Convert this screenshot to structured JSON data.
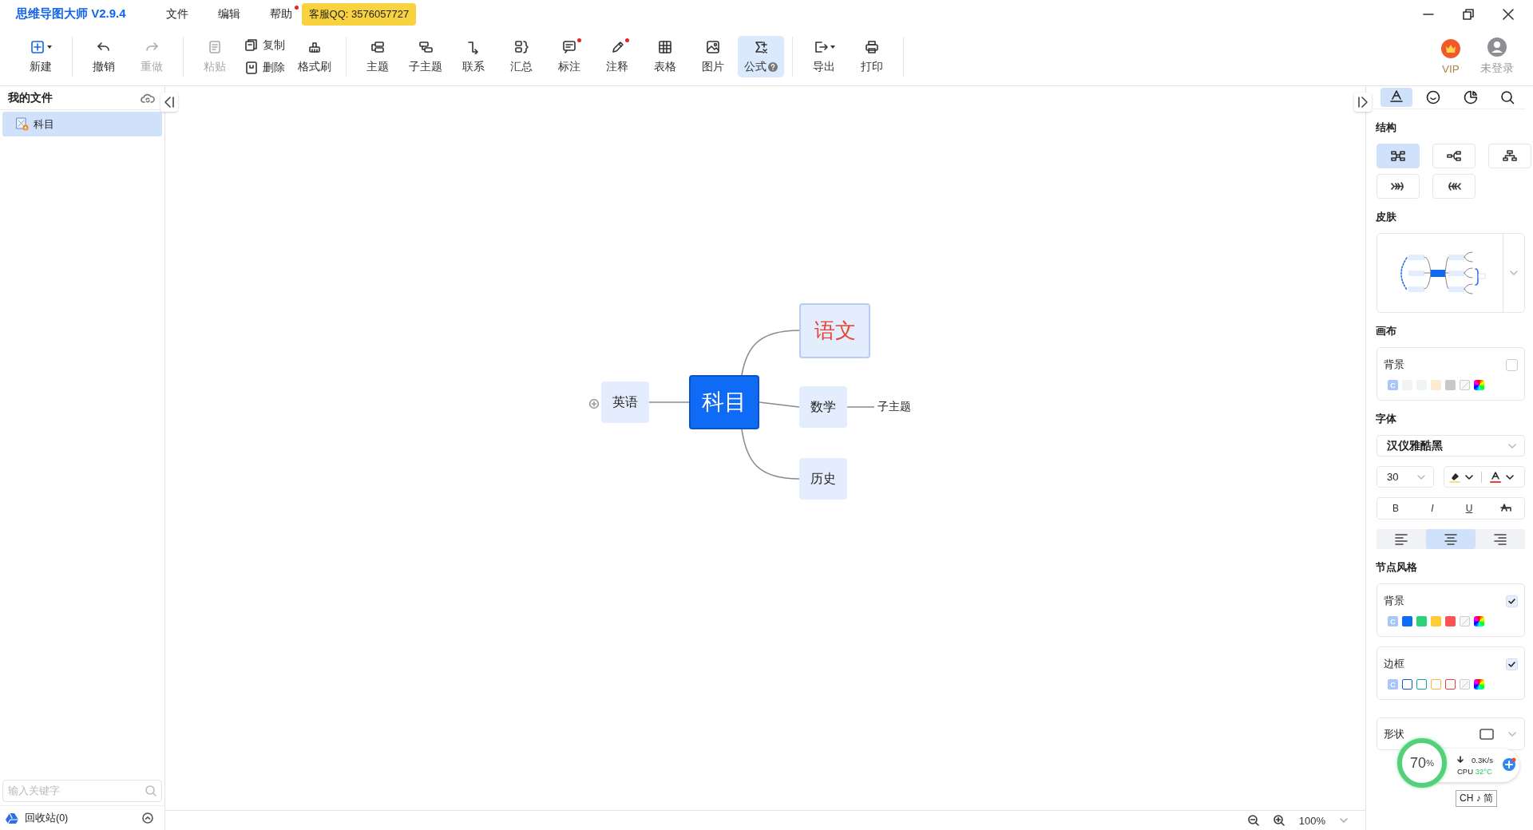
{
  "app": {
    "title": "思维导图大师 V2.9.4",
    "menus": [
      {
        "label": "文件",
        "dot": false
      },
      {
        "label": "编辑",
        "dot": false
      },
      {
        "label": "帮助",
        "dot": true
      }
    ],
    "support_badge": "客服QQ: 3576057727"
  },
  "toolbar": {
    "groups": [
      [
        {
          "kind": "new",
          "label": "新建",
          "dropdown": true,
          "disabled": false,
          "selected": false,
          "dot": false
        }
      ],
      [
        {
          "kind": "undo",
          "label": "撤销",
          "dropdown": false,
          "disabled": false,
          "selected": false,
          "dot": false
        },
        {
          "kind": "redo",
          "label": "重做",
          "dropdown": false,
          "disabled": true,
          "selected": false,
          "dot": false
        }
      ],
      [
        {
          "kind": "paste",
          "label": "粘贴",
          "dropdown": false,
          "disabled": true,
          "selected": false,
          "dot": false
        },
        {
          "kind": "pair",
          "items": [
            {
              "kind": "copy",
              "label": "复制"
            },
            {
              "kind": "delete",
              "label": "删除"
            }
          ]
        },
        {
          "kind": "brush",
          "label": "格式刷",
          "dropdown": false,
          "disabled": false,
          "selected": false,
          "dot": false
        }
      ],
      [
        {
          "kind": "topic",
          "label": "主题",
          "dropdown": false,
          "disabled": false,
          "selected": false,
          "dot": false
        },
        {
          "kind": "subtopic",
          "label": "子主题",
          "dropdown": false,
          "disabled": false,
          "selected": false,
          "dot": false
        },
        {
          "kind": "relation",
          "label": "联系",
          "dropdown": false,
          "disabled": false,
          "selected": false,
          "dot": false
        },
        {
          "kind": "summary",
          "label": "汇总",
          "dropdown": false,
          "disabled": false,
          "selected": false,
          "dot": false
        },
        {
          "kind": "note",
          "label": "标注",
          "dropdown": false,
          "disabled": false,
          "selected": false,
          "dot": true
        },
        {
          "kind": "comment",
          "label": "注释",
          "dropdown": false,
          "disabled": false,
          "selected": false,
          "dot": true
        },
        {
          "kind": "table",
          "label": "表格",
          "dropdown": false,
          "disabled": false,
          "selected": false,
          "dot": false
        },
        {
          "kind": "image",
          "label": "图片",
          "dropdown": false,
          "disabled": false,
          "selected": false,
          "dot": false
        },
        {
          "kind": "formula",
          "label": "公式",
          "dropdown": false,
          "disabled": false,
          "selected": true,
          "dot": false
        }
      ],
      [
        {
          "kind": "export",
          "label": "导出",
          "dropdown": true,
          "disabled": false,
          "selected": false,
          "dot": false
        },
        {
          "kind": "print",
          "label": "打印",
          "dropdown": false,
          "disabled": false,
          "selected": false,
          "dot": false
        }
      ]
    ],
    "account": {
      "vip": "VIP",
      "login": "未登录"
    }
  },
  "sidebar": {
    "title": "我的文件",
    "files": [
      {
        "label": "科目",
        "selected": true
      }
    ],
    "search": {
      "placeholder": "输入关键字"
    },
    "recycle": "回收站(0)"
  },
  "mindmap": {
    "root": "科目",
    "right_branches": [
      {
        "label": "语文",
        "selected": true,
        "collapsed": false,
        "color": "#e8432e"
      },
      {
        "label": "数学",
        "selected": false,
        "collapsed": false,
        "color": "#222222",
        "children": [
          {
            "label": "子主题"
          }
        ]
      },
      {
        "label": "历史",
        "selected": false,
        "collapsed": false,
        "color": "#222222"
      }
    ],
    "left_branches": [
      {
        "label": "英语",
        "selected": false,
        "collapsed": true,
        "color": "#222222"
      }
    ]
  },
  "panel": {
    "tabs": [
      {
        "kind": "style",
        "selected": true
      },
      {
        "kind": "emoji",
        "selected": false
      },
      {
        "kind": "sticker",
        "selected": false
      },
      {
        "kind": "search",
        "selected": false
      }
    ],
    "structure": {
      "title": "结构",
      "options": [
        {
          "kind": "mind",
          "selected": true
        },
        {
          "kind": "right",
          "selected": false
        },
        {
          "kind": "org",
          "selected": false
        },
        {
          "kind": "fishright",
          "selected": false
        },
        {
          "kind": "fishleft",
          "selected": false
        }
      ]
    },
    "skin": {
      "title": "皮肤"
    },
    "canvas": {
      "title": "画布",
      "background": {
        "label": "背景",
        "checked": false,
        "swatches": [
          {
            "kind": "custom",
            "text": "C"
          },
          {
            "kind": "color",
            "color": "#f2f3f5"
          },
          {
            "kind": "color",
            "color": "#eff5f5"
          },
          {
            "kind": "color",
            "color": "#fdebd0"
          },
          {
            "kind": "color",
            "color": "#c8c8c8"
          },
          {
            "kind": "none"
          },
          {
            "kind": "picker"
          }
        ]
      }
    },
    "font": {
      "title": "字体",
      "family": "汉仪雅酷黑",
      "size": "30",
      "styles": [
        {
          "kind": "bold",
          "text": "B"
        },
        {
          "kind": "italic",
          "text": "I"
        },
        {
          "kind": "underline",
          "text": "U"
        },
        {
          "kind": "strike"
        }
      ],
      "align": [
        {
          "kind": "left",
          "selected": false
        },
        {
          "kind": "center",
          "selected": true
        },
        {
          "kind": "right",
          "selected": false
        }
      ]
    },
    "node_style": {
      "title": "节点风格",
      "background": {
        "label": "背景",
        "checked": true,
        "swatches": [
          {
            "kind": "custom",
            "text": "C"
          },
          {
            "kind": "color",
            "color": "#0f6af5"
          },
          {
            "kind": "color",
            "color": "#2bd27a"
          },
          {
            "kind": "color",
            "color": "#ffcc33"
          },
          {
            "kind": "color",
            "color": "#fd5353"
          },
          {
            "kind": "none"
          },
          {
            "kind": "picker"
          }
        ]
      },
      "border": {
        "label": "边框",
        "checked": true,
        "swatches": [
          {
            "kind": "custom",
            "text": "C"
          },
          {
            "kind": "outline",
            "color": "#1256d6"
          },
          {
            "kind": "outline",
            "color": "#16a0a8"
          },
          {
            "kind": "outline",
            "color": "#fbb93a"
          },
          {
            "kind": "outline",
            "color": "#f03c3c"
          },
          {
            "kind": "none"
          },
          {
            "kind": "picker"
          }
        ]
      },
      "shape": {
        "label": "形状"
      }
    }
  },
  "status": {
    "zoom": "100%"
  },
  "cpu_widget": {
    "percent": "70",
    "unit": "%",
    "speed": "0.3K/s",
    "cpu": "CPU",
    "temp": "32°C"
  },
  "ime": {
    "text": "CH ♪ 简"
  }
}
